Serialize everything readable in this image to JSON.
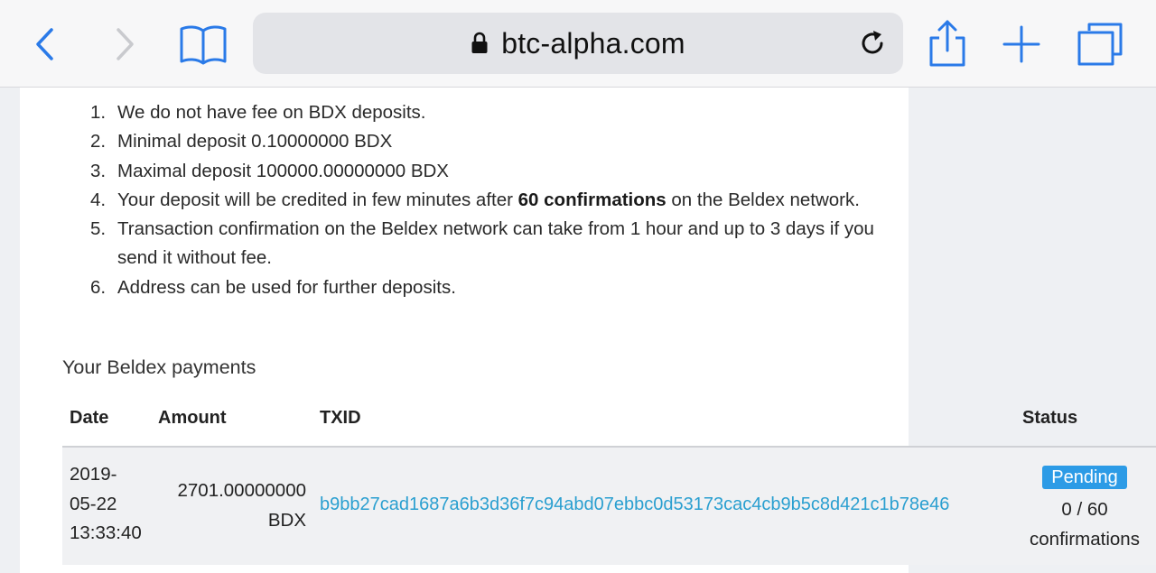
{
  "browser": {
    "url": "btc-alpha.com"
  },
  "deposit_rules": [
    {
      "num": "1.",
      "text": "We do not have fee on BDX deposits."
    },
    {
      "num": "2.",
      "text": "Minimal deposit 0.10000000 BDX"
    },
    {
      "num": "3.",
      "text": "Maximal deposit 100000.00000000 BDX"
    },
    {
      "num": "4.",
      "text_before": "Your deposit will be credited in few minutes after ",
      "text_bold": "60 confirmations",
      "text_after": " on the Beldex network."
    },
    {
      "num": "5.",
      "text": "Transaction confirmation on the Beldex network can take from 1 hour and up to 3 days if you send it without fee."
    },
    {
      "num": "6.",
      "text": "Address can be used for further deposits."
    }
  ],
  "payments": {
    "title": "Your Beldex payments",
    "columns": {
      "date": "Date",
      "amount": "Amount",
      "txid": "TXID",
      "status": "Status"
    },
    "rows": [
      {
        "date_line1": "2019-",
        "date_line2": "05-22",
        "date_line3": "13:33:40",
        "amount_value": "2701.00000000",
        "amount_unit": "BDX",
        "txid": "b9bb27cad1687a6b3d36f7c94abd07ebbc0d53173cac4cb9b5c8d421c1b78e46",
        "status_badge": "Pending",
        "confirmations_count": "0 / 60",
        "confirmations_label": "confirmations"
      }
    ]
  },
  "colors": {
    "accent": "#2a7ae8",
    "txid_link": "#2a9fd0",
    "badge": "#2c9be6"
  },
  "icons": {
    "back": "chevron-left-icon",
    "forward": "chevron-right-icon",
    "bookmarks": "book-icon",
    "lock": "lock-icon",
    "reload": "reload-icon",
    "share": "share-icon",
    "new_tab": "plus-icon",
    "tabs": "tabs-icon"
  }
}
